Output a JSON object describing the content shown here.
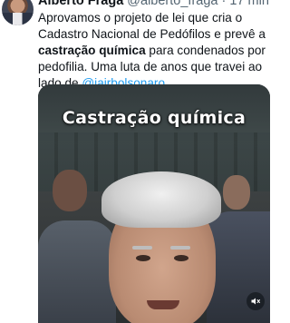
{
  "tweet": {
    "author": "Alberto Fraga",
    "handle": "@alberto_fraga",
    "separator": "·",
    "time": "17 min",
    "text_parts": [
      "Aprovamos o projeto de lei que cria o Cadastro Nacional de Pedófilos e prevê a ",
      "castração química",
      " para condenados por pedofilia. Uma luta de anos que travei ao lado de ",
      "@jairbolsonaro",
      "."
    ]
  },
  "media": {
    "caption": "Castração química",
    "mute_icon": "speaker-muted-icon"
  },
  "colors": {
    "link": "#1d9bf0",
    "text": "#0f1419",
    "secondary": "#536471"
  }
}
